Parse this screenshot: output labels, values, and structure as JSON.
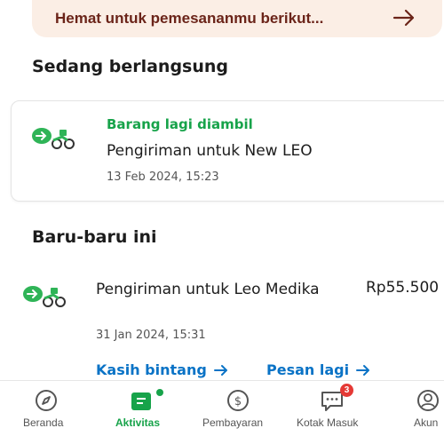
{
  "promo": {
    "text": "Hemat untuk pemesananmu berikut..."
  },
  "sections": {
    "ongoing": "Sedang berlangsung",
    "recent": "Baru-baru ini"
  },
  "ongoing_order": {
    "status": "Barang lagi diambil",
    "title": "Pengiriman untuk New LEO",
    "date": "13 Feb 2024, 15:23"
  },
  "recent_order": {
    "title": "Pengiriman untuk Leo Medika",
    "price": "Rp55.500",
    "date": "31 Jan 2024, 15:31",
    "actions": {
      "rate": "Kasih bintang",
      "reorder": "Pesan lagi"
    }
  },
  "nav": {
    "items": [
      {
        "label": "Beranda",
        "icon": "compass-icon"
      },
      {
        "label": "Aktivitas",
        "icon": "activity-icon"
      },
      {
        "label": "Pembayaran",
        "icon": "dollar-icon"
      },
      {
        "label": "Kotak Masuk",
        "icon": "chat-icon",
        "badge": "3"
      },
      {
        "label": "Akun",
        "icon": "account-icon"
      }
    ]
  },
  "colors": {
    "accent": "#17a34a",
    "link": "#0a73c6",
    "promo_text": "#6b2419",
    "promo_bg": "#fbeee5",
    "badge": "#e53935"
  }
}
